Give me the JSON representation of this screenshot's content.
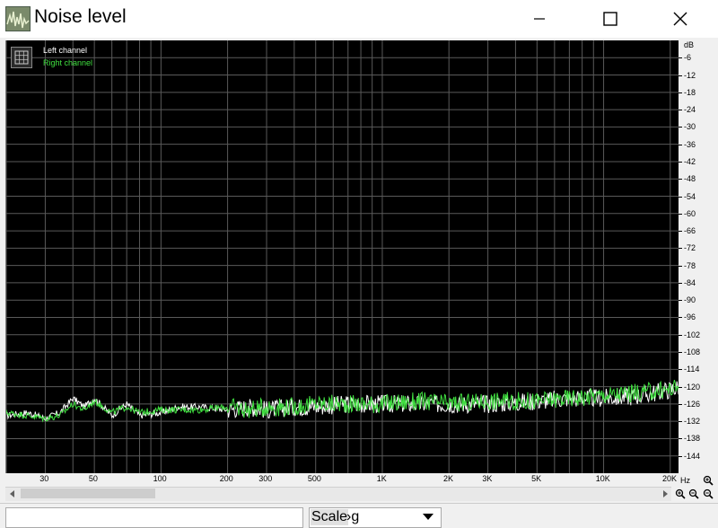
{
  "window": {
    "title": "Noise level",
    "icon": "spectrum-app-icon",
    "controls": [
      "minimize-icon",
      "maximize-icon",
      "close-icon"
    ]
  },
  "legend": {
    "left_channel": "Left channel",
    "right_channel": "Right channel"
  },
  "colors": {
    "plot_background": "#000000",
    "grid": "#5a5a5a",
    "left_channel": "#ffffff",
    "right_channel": "#40e040"
  },
  "chart_data": {
    "type": "line",
    "x_scale": "log",
    "y_unit": "dB",
    "x_unit": "Hz",
    "xlim": [
      20,
      22000
    ],
    "ylim": [
      -150,
      0
    ],
    "grid": true,
    "legend_position": "top-left",
    "yticks": [
      -6,
      -12,
      -18,
      -24,
      -30,
      -36,
      -42,
      -48,
      -54,
      -60,
      -66,
      -72,
      -78,
      -84,
      -90,
      -96,
      -102,
      -108,
      -114,
      -120,
      -126,
      -132,
      -138,
      -144
    ],
    "ytick_labels": [
      "-6",
      "-12",
      "-18",
      "-24",
      "-30",
      "-36",
      "-42",
      "-48",
      "-54",
      "-60",
      "-66",
      "-72",
      "-78",
      "-84",
      "-90",
      "-96",
      "-102",
      "-108",
      "-114",
      "-120",
      "-126",
      "-132",
      "-138",
      "-144"
    ],
    "xticks": [
      30,
      50,
      100,
      200,
      300,
      500,
      1000,
      2000,
      3000,
      5000,
      10000,
      20000
    ],
    "xtick_labels": [
      "30",
      "50",
      "100",
      "200",
      "300",
      "500",
      "1K",
      "2K",
      "3K",
      "5K",
      "10K",
      "20K"
    ],
    "series": [
      {
        "name": "Left channel",
        "color": "#ffffff",
        "x": [
          20,
          25,
          30,
          35,
          40,
          45,
          50,
          60,
          70,
          80,
          100,
          120,
          150,
          200,
          250,
          300,
          400,
          500,
          700,
          1000,
          1500,
          2000,
          3000,
          5000,
          7000,
          10000,
          15000,
          20000,
          22000
        ],
        "y": [
          -130,
          -129,
          -131,
          -129,
          -124,
          -127,
          -124,
          -130,
          -126,
          -130,
          -129,
          -127,
          -127,
          -128,
          -127,
          -128,
          -127,
          -127,
          -126,
          -126,
          -126,
          -126,
          -126,
          -125,
          -124,
          -124,
          -123,
          -121,
          -120
        ]
      },
      {
        "name": "Right channel",
        "color": "#40e040",
        "x": [
          20,
          25,
          30,
          35,
          40,
          45,
          50,
          60,
          70,
          80,
          100,
          120,
          150,
          200,
          250,
          300,
          400,
          500,
          700,
          1000,
          1500,
          2000,
          3000,
          5000,
          7000,
          10000,
          15000,
          20000,
          22000
        ],
        "y": [
          -129,
          -130,
          -131,
          -130,
          -126,
          -128,
          -125,
          -129,
          -127,
          -129,
          -128,
          -128,
          -128,
          -127,
          -128,
          -127,
          -127,
          -126,
          -126,
          -126,
          -125,
          -126,
          -125,
          -125,
          -124,
          -123,
          -122,
          -121,
          -120
        ]
      }
    ]
  },
  "axis": {
    "y_unit_label": "dB",
    "x_unit_label": "Hz"
  },
  "bottom": {
    "scale_label": "Scale",
    "scale_value": "›g"
  },
  "icons": {
    "zoom_in": "zoom-in-icon",
    "zoom_out": "zoom-out-icon",
    "scroll_left": "arrow-left-icon",
    "scroll_right": "arrow-right-icon",
    "dropdown": "chevron-down-icon"
  }
}
